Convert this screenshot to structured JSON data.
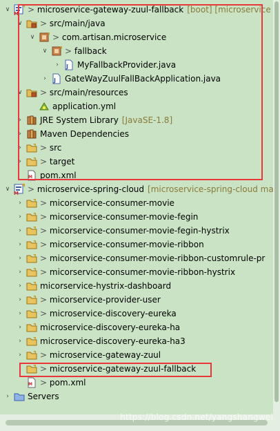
{
  "tree": {
    "rows": [
      {
        "depth": 0,
        "twisty": "open",
        "icon": "maven-project-icon",
        "decorator": ">",
        "name": "microservice-gateway-zuul-fallback",
        "extra": "[boot] [microservice",
        "kind": "project"
      },
      {
        "depth": 1,
        "twisty": "open",
        "icon": "source-folder-icon",
        "decorator": ">",
        "name": "src/main/java",
        "extra": "",
        "kind": "folder"
      },
      {
        "depth": 2,
        "twisty": "open",
        "icon": "package-icon",
        "decorator": ">",
        "name": "com.artisan.microservice",
        "extra": "",
        "kind": "package"
      },
      {
        "depth": 3,
        "twisty": "open",
        "icon": "package-icon",
        "decorator": ">",
        "name": "fallback",
        "extra": "",
        "kind": "package"
      },
      {
        "depth": 4,
        "twisty": "closed",
        "icon": "java-file-icon",
        "decorator": "",
        "name": "MyFallbackProvider.java",
        "extra": "",
        "kind": "file"
      },
      {
        "depth": 3,
        "twisty": "closed",
        "icon": "java-file-icon",
        "decorator": "",
        "name": "GateWayZuulFallBackApplication.java",
        "extra": "",
        "kind": "file"
      },
      {
        "depth": 1,
        "twisty": "open",
        "icon": "source-folder-icon",
        "decorator": ">",
        "name": "src/main/resources",
        "extra": "",
        "kind": "folder"
      },
      {
        "depth": 2,
        "twisty": "none",
        "icon": "yaml-file-icon",
        "decorator": "",
        "name": "application.yml",
        "extra": "",
        "kind": "file"
      },
      {
        "depth": 1,
        "twisty": "closed",
        "icon": "library-icon",
        "decorator": "",
        "name": "JRE System Library",
        "extra": "[JavaSE-1.8]",
        "kind": "library"
      },
      {
        "depth": 1,
        "twisty": "closed",
        "icon": "library-icon",
        "decorator": "",
        "name": "Maven Dependencies",
        "extra": "",
        "kind": "library"
      },
      {
        "depth": 1,
        "twisty": "closed",
        "icon": "folder-icon",
        "decorator": ">",
        "name": "src",
        "extra": "",
        "kind": "folder"
      },
      {
        "depth": 1,
        "twisty": "closed",
        "icon": "folder-icon",
        "decorator": ">",
        "name": "target",
        "extra": "",
        "kind": "folder"
      },
      {
        "depth": 1,
        "twisty": "none",
        "icon": "xml-file-icon",
        "decorator": "",
        "name": "pom.xml",
        "extra": "",
        "kind": "file"
      },
      {
        "depth": 0,
        "twisty": "open",
        "icon": "maven-project-icon",
        "decorator": ">",
        "name": "microservice-spring-cloud",
        "extra": "[microservice-spring-cloud maste",
        "kind": "project"
      },
      {
        "depth": 1,
        "twisty": "closed",
        "icon": "folder-icon",
        "decorator": ">",
        "name": "micorservice-consumer-movie",
        "extra": "",
        "kind": "folder"
      },
      {
        "depth": 1,
        "twisty": "closed",
        "icon": "folder-icon",
        "decorator": ">",
        "name": "micorservice-consumer-movie-fegin",
        "extra": "",
        "kind": "folder"
      },
      {
        "depth": 1,
        "twisty": "closed",
        "icon": "folder-icon",
        "decorator": ">",
        "name": "micorservice-consumer-movie-fegin-hystrix",
        "extra": "",
        "kind": "folder"
      },
      {
        "depth": 1,
        "twisty": "closed",
        "icon": "folder-icon",
        "decorator": ">",
        "name": "micorservice-consumer-movie-ribbon",
        "extra": "",
        "kind": "folder"
      },
      {
        "depth": 1,
        "twisty": "closed",
        "icon": "folder-icon",
        "decorator": ">",
        "name": "micorservice-consumer-movie-ribbon-customrule-pr",
        "extra": "",
        "kind": "folder"
      },
      {
        "depth": 1,
        "twisty": "closed",
        "icon": "folder-icon",
        "decorator": ">",
        "name": "micorservice-consumer-movie-ribbon-hystrix",
        "extra": "",
        "kind": "folder"
      },
      {
        "depth": 1,
        "twisty": "closed",
        "icon": "folder-icon",
        "decorator": "",
        "name": "micorservice-hystrix-dashboard",
        "extra": "",
        "kind": "folder"
      },
      {
        "depth": 1,
        "twisty": "closed",
        "icon": "folder-icon",
        "decorator": ">",
        "name": "micorservice-provider-user",
        "extra": "",
        "kind": "folder"
      },
      {
        "depth": 1,
        "twisty": "closed",
        "icon": "folder-icon",
        "decorator": ">",
        "name": "microservice-discovery-eureka",
        "extra": "",
        "kind": "folder"
      },
      {
        "depth": 1,
        "twisty": "closed",
        "icon": "folder-icon",
        "decorator": "",
        "name": "microservice-discovery-eureka-ha",
        "extra": "",
        "kind": "folder"
      },
      {
        "depth": 1,
        "twisty": "closed",
        "icon": "folder-icon",
        "decorator": "",
        "name": "microservice-discovery-eureka-ha3",
        "extra": "",
        "kind": "folder"
      },
      {
        "depth": 1,
        "twisty": "closed",
        "icon": "folder-icon",
        "decorator": ">",
        "name": "microservice-gateway-zuul",
        "extra": "",
        "kind": "folder"
      },
      {
        "depth": 1,
        "twisty": "closed",
        "icon": "folder-icon",
        "decorator": ">",
        "name": "microservice-gateway-zuul-fallback",
        "extra": "",
        "kind": "folder"
      },
      {
        "depth": 1,
        "twisty": "none",
        "icon": "xml-file-icon",
        "decorator": ">",
        "name": "pom.xml",
        "extra": "",
        "kind": "file"
      },
      {
        "depth": 0,
        "twisty": "closed",
        "icon": "servers-folder-icon",
        "decorator": "",
        "name": "Servers",
        "extra": "",
        "kind": "folder"
      }
    ]
  },
  "colors": {
    "background": "#c9e3c4",
    "highlight_border": "#e8363a",
    "decorator_text": "#555555",
    "extra_text": "#8a7a3a"
  },
  "watermark": "https://blog.csdn.net/yangshangwei"
}
